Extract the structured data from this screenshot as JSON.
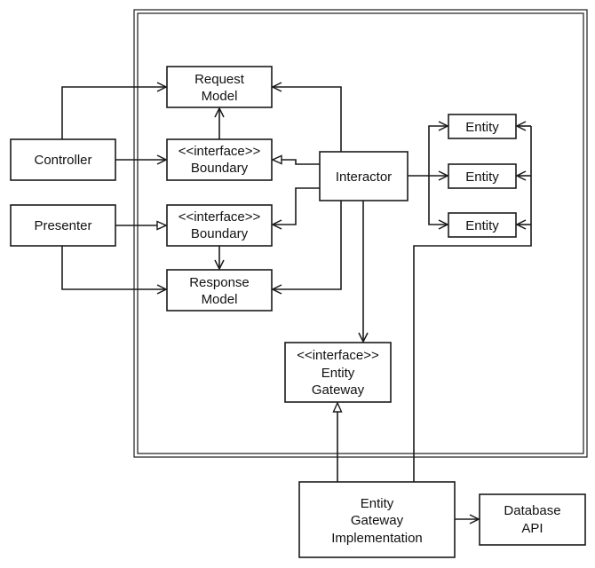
{
  "diagram": {
    "boundary": {
      "name": "application-core-boundary"
    },
    "nodes": {
      "controller": {
        "lines": [
          "Controller"
        ]
      },
      "presenter": {
        "lines": [
          "Presenter"
        ]
      },
      "request_model": {
        "lines": [
          "Request",
          "Model"
        ]
      },
      "input_boundary": {
        "lines": [
          "<<interface>>",
          "Boundary"
        ]
      },
      "output_boundary": {
        "lines": [
          "<<interface>>",
          "Boundary"
        ]
      },
      "response_model": {
        "lines": [
          "Response",
          "Model"
        ]
      },
      "interactor": {
        "lines": [
          "Interactor"
        ]
      },
      "entity_1": {
        "lines": [
          "Entity"
        ]
      },
      "entity_2": {
        "lines": [
          "Entity"
        ]
      },
      "entity_3": {
        "lines": [
          "Entity"
        ]
      },
      "entity_gateway": {
        "lines": [
          "<<interface>>",
          "Entity",
          "Gateway"
        ]
      },
      "entity_gateway_impl": {
        "lines": [
          "Entity",
          "Gateway",
          "Implementation"
        ]
      },
      "database_api": {
        "lines": [
          "Database",
          "API"
        ]
      }
    },
    "edges": [
      {
        "from": "controller",
        "to": "request_model",
        "kind": "dependency"
      },
      {
        "from": "controller",
        "to": "input_boundary",
        "kind": "dependency"
      },
      {
        "from": "input_boundary",
        "to": "request_model",
        "kind": "dependency"
      },
      {
        "from": "interactor",
        "to": "request_model",
        "kind": "dependency"
      },
      {
        "from": "interactor",
        "to": "input_boundary",
        "kind": "realization"
      },
      {
        "from": "interactor",
        "to": "output_boundary",
        "kind": "dependency"
      },
      {
        "from": "interactor",
        "to": "response_model",
        "kind": "dependency"
      },
      {
        "from": "presenter",
        "to": "output_boundary",
        "kind": "realization"
      },
      {
        "from": "presenter",
        "to": "response_model",
        "kind": "dependency"
      },
      {
        "from": "output_boundary",
        "to": "response_model",
        "kind": "dependency"
      },
      {
        "from": "interactor",
        "to": "entity_1",
        "kind": "dependency"
      },
      {
        "from": "interactor",
        "to": "entity_2",
        "kind": "dependency"
      },
      {
        "from": "interactor",
        "to": "entity_3",
        "kind": "dependency"
      },
      {
        "from": "interactor",
        "to": "entity_gateway",
        "kind": "dependency"
      },
      {
        "from": "entity_gateway_impl",
        "to": "entity_gateway",
        "kind": "realization"
      },
      {
        "from": "entity_gateway_impl",
        "to": "entity_1",
        "kind": "dependency"
      },
      {
        "from": "entity_gateway_impl",
        "to": "entity_2",
        "kind": "dependency"
      },
      {
        "from": "entity_gateway_impl",
        "to": "entity_3",
        "kind": "dependency"
      },
      {
        "from": "entity_gateway_impl",
        "to": "database_api",
        "kind": "dependency"
      }
    ]
  }
}
